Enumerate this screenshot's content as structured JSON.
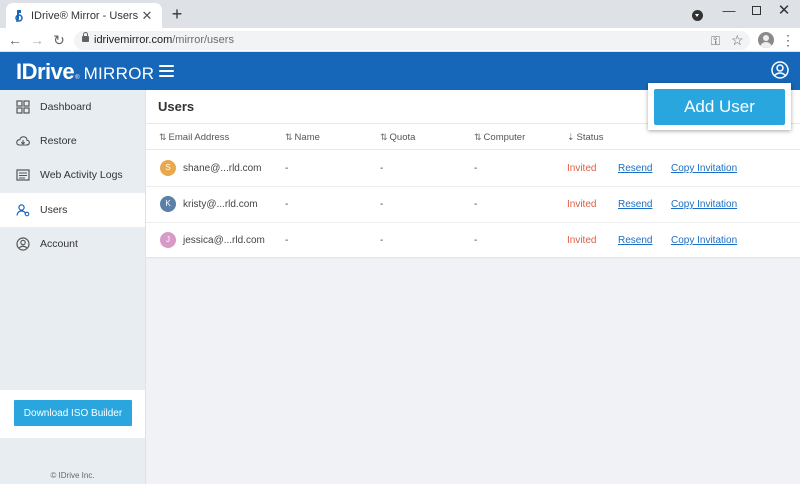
{
  "browser": {
    "tab_title": "IDrive® Mirror - Users",
    "tab_close": "✕",
    "new_tab": "+",
    "url_host": "idrivemirror.com",
    "url_path": "/mirror/users",
    "back": "←",
    "forward": "→",
    "reload": "↻",
    "minimize": "—",
    "close": "✕",
    "star": "☆",
    "key": "⚿",
    "menu": "⋮"
  },
  "header": {
    "logo_text": "IDrive",
    "logo_reg": "®",
    "logo_product": "MIRROR",
    "brand_color": "#1667b9"
  },
  "sidebar": {
    "items": [
      {
        "label": "Dashboard",
        "icon": "dashboard-icon"
      },
      {
        "label": "Restore",
        "icon": "cloud-restore-icon"
      },
      {
        "label": "Web Activity Logs",
        "icon": "logs-icon"
      },
      {
        "label": "Users",
        "icon": "users-icon",
        "active": true
      },
      {
        "label": "Account",
        "icon": "account-icon"
      }
    ],
    "iso_button": "Download ISO Builder",
    "copyright": "© IDrive Inc."
  },
  "main": {
    "title": "Users",
    "add_user_label": "Add User",
    "columns": [
      "Email Address",
      "Name",
      "Quota",
      "Computer",
      "Status"
    ],
    "sort_glyph": "⇅",
    "status_sort_glyph": "⇣",
    "rows": [
      {
        "initial": "S",
        "avatar_color": "#e8a84e",
        "email": "shane@...rld.com",
        "name": "-",
        "quota": "-",
        "computer": "-",
        "status": "Invited",
        "resend": "Resend",
        "copy": "Copy Invitation"
      },
      {
        "initial": "K",
        "avatar_color": "#5b7fa6",
        "email": "kristy@...rld.com",
        "name": "-",
        "quota": "-",
        "computer": "-",
        "status": "Invited",
        "resend": "Resend",
        "copy": "Copy Invitation"
      },
      {
        "initial": "J",
        "avatar_color": "#d89ac8",
        "email": "jessica@...rld.com",
        "name": "-",
        "quota": "-",
        "computer": "-",
        "status": "Invited",
        "resend": "Resend",
        "copy": "Copy Invitation"
      }
    ]
  }
}
